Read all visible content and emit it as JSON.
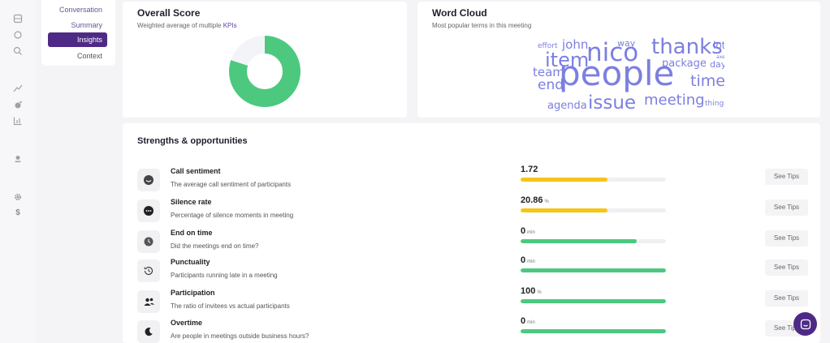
{
  "rail": {
    "icons": [
      "grid-icon",
      "circle-icon",
      "search-icon",
      "trend-icon",
      "bubble-icon",
      "chart-icon",
      "person-icon",
      "gear-icon",
      "dollar-icon"
    ],
    "dollar_glyph": "$"
  },
  "subnav": {
    "items": [
      "Conversation",
      "Summary",
      "Insights",
      "Context"
    ],
    "active_index": 2
  },
  "score": {
    "title": "Overall Score",
    "subtitle_prefix": "Weighted average of multiple ",
    "subtitle_kpi": "KPIs",
    "fraction": 0.8,
    "color": "#4cc97f",
    "track_color": "#f3f4f8"
  },
  "wordcloud": {
    "title": "Word Cloud",
    "subtitle": "Most popular terms in this meeting",
    "color": "#7c7fe0",
    "words": [
      "people",
      "nico",
      "thanks",
      "item",
      "issue",
      "meeting",
      "time",
      "end",
      "team",
      "agenda",
      "package",
      "john",
      "way",
      "day",
      "lot",
      "effort",
      "axel",
      "things"
    ]
  },
  "strengths": {
    "title": "Strengths & opportunities",
    "see_tips_label": "See Tips",
    "colors": {
      "warn": "#f5c518",
      "good": "#4cc97f",
      "track": "#f0f0f3"
    },
    "rows": [
      {
        "icon": "smile-icon",
        "name": "Call sentiment",
        "desc": "The average call sentiment of participants",
        "value": "1.72",
        "unit": "",
        "fill": 0.6,
        "status": "warn"
      },
      {
        "icon": "ellipsis-chat-icon",
        "name": "Silence rate",
        "desc": "Percentage of silence moments in meeting",
        "value": "20.86",
        "unit": "%",
        "fill": 0.6,
        "status": "warn"
      },
      {
        "icon": "clock-icon",
        "name": "End on time",
        "desc": "Did the meetings end on time?",
        "value": "0",
        "unit": "min",
        "fill": 0.8,
        "status": "good"
      },
      {
        "icon": "history-icon",
        "name": "Punctuality",
        "desc": "Participants running late in a meeting",
        "value": "0",
        "unit": "min",
        "fill": 1.0,
        "status": "good"
      },
      {
        "icon": "users-icon",
        "name": "Participation",
        "desc": "The ratio of invitees vs actual participants",
        "value": "100",
        "unit": "%",
        "fill": 1.0,
        "status": "good"
      },
      {
        "icon": "moon-icon",
        "name": "Overtime",
        "desc": "Are people in meetings outside business hours?",
        "value": "0",
        "unit": "min",
        "fill": 1.0,
        "status": "good"
      }
    ]
  }
}
